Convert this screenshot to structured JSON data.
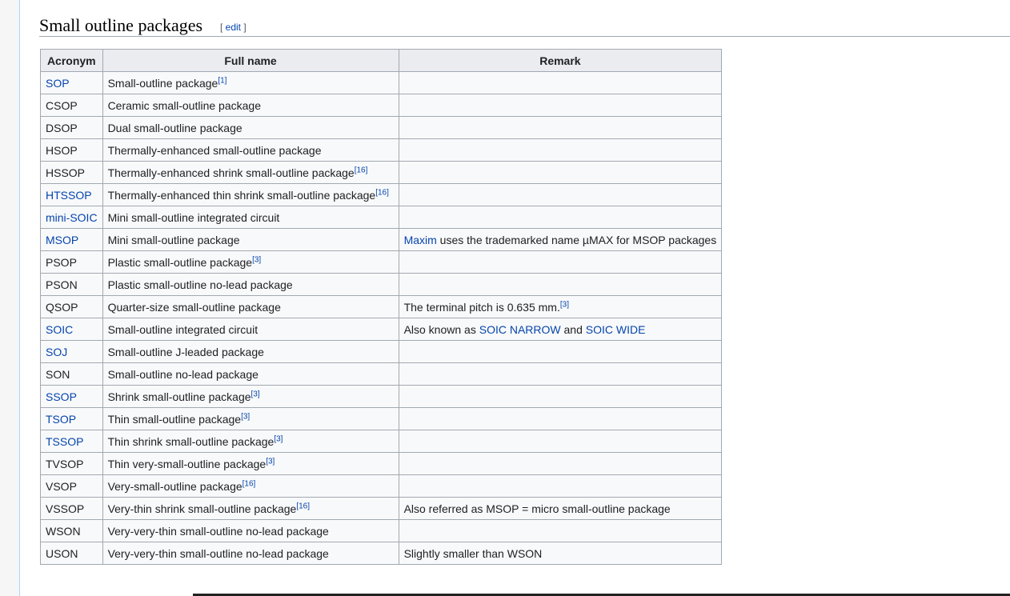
{
  "section": {
    "title": "Small outline packages",
    "edit_open": "[ ",
    "edit_label": "edit",
    "edit_close": " ]"
  },
  "table": {
    "headers": [
      "Acronym",
      "Full name",
      "Remark"
    ],
    "rows": [
      {
        "acronym": "SOP",
        "acronym_link": true,
        "full": "Small-outline package",
        "full_ref": "[1]",
        "remark": []
      },
      {
        "acronym": "CSOP",
        "acronym_link": false,
        "full": "Ceramic small-outline package",
        "full_ref": "",
        "remark": []
      },
      {
        "acronym": "DSOP",
        "acronym_link": false,
        "full": "Dual small-outline package",
        "full_ref": "",
        "remark": []
      },
      {
        "acronym": "HSOP",
        "acronym_link": false,
        "full": "Thermally-enhanced small-outline package",
        "full_ref": "",
        "remark": []
      },
      {
        "acronym": "HSSOP",
        "acronym_link": false,
        "full": "Thermally-enhanced shrink small-outline package",
        "full_ref": "[16]",
        "remark": []
      },
      {
        "acronym": "HTSSOP",
        "acronym_link": true,
        "full": "Thermally-enhanced thin shrink small-outline package",
        "full_ref": "[16]",
        "remark": []
      },
      {
        "acronym": "mini-SOIC",
        "acronym_link": true,
        "full": "Mini small-outline integrated circuit",
        "full_ref": "",
        "remark": []
      },
      {
        "acronym": "MSOP",
        "acronym_link": true,
        "full": "Mini small-outline package",
        "full_ref": "",
        "remark": [
          {
            "text": "Maxim",
            "type": "link"
          },
          {
            "text": " uses the trademarked name µMAX for MSOP packages",
            "type": "text"
          }
        ]
      },
      {
        "acronym": "PSOP",
        "acronym_link": false,
        "full": "Plastic small-outline package",
        "full_ref": "[3]",
        "remark": []
      },
      {
        "acronym": "PSON",
        "acronym_link": false,
        "full": "Plastic small-outline no-lead package",
        "full_ref": "",
        "remark": []
      },
      {
        "acronym": "QSOP",
        "acronym_link": false,
        "full": "Quarter-size small-outline package",
        "full_ref": "",
        "remark": [
          {
            "text": "The terminal pitch is 0.635 mm.",
            "type": "text"
          },
          {
            "text": "[3]",
            "type": "ref"
          }
        ]
      },
      {
        "acronym": "SOIC",
        "acronym_link": true,
        "full": "Small-outline integrated circuit",
        "full_ref": "",
        "remark": [
          {
            "text": "Also known as ",
            "type": "text"
          },
          {
            "text": "SOIC NARROW",
            "type": "link"
          },
          {
            "text": " and ",
            "type": "text"
          },
          {
            "text": "SOIC WIDE",
            "type": "link"
          }
        ]
      },
      {
        "acronym": "SOJ",
        "acronym_link": true,
        "full": "Small-outline J-leaded package",
        "full_ref": "",
        "remark": []
      },
      {
        "acronym": "SON",
        "acronym_link": false,
        "full": "Small-outline no-lead package",
        "full_ref": "",
        "remark": []
      },
      {
        "acronym": "SSOP",
        "acronym_link": true,
        "full": "Shrink small-outline package",
        "full_ref": "[3]",
        "remark": []
      },
      {
        "acronym": "TSOP",
        "acronym_link": true,
        "full": "Thin small-outline package",
        "full_ref": "[3]",
        "remark": []
      },
      {
        "acronym": "TSSOP",
        "acronym_link": true,
        "full": "Thin shrink small-outline package",
        "full_ref": "[3]",
        "remark": []
      },
      {
        "acronym": "TVSOP",
        "acronym_link": false,
        "full": "Thin very-small-outline package",
        "full_ref": "[3]",
        "remark": []
      },
      {
        "acronym": "VSOP",
        "acronym_link": false,
        "full": "Very-small-outline package",
        "full_ref": "[16]",
        "remark": []
      },
      {
        "acronym": "VSSOP",
        "acronym_link": false,
        "full": "Very-thin shrink small-outline package",
        "full_ref": "[16]",
        "remark": [
          {
            "text": "Also referred as MSOP = micro small-outline package",
            "type": "text"
          }
        ]
      },
      {
        "acronym": "WSON",
        "acronym_link": false,
        "full": "Very-very-thin small-outline no-lead package",
        "full_ref": "",
        "remark": []
      },
      {
        "acronym": "USON",
        "acronym_link": false,
        "full": "Very-very-thin small-outline no-lead package",
        "full_ref": "",
        "remark": [
          {
            "text": "Slightly smaller than WSON",
            "type": "text"
          }
        ]
      }
    ]
  }
}
